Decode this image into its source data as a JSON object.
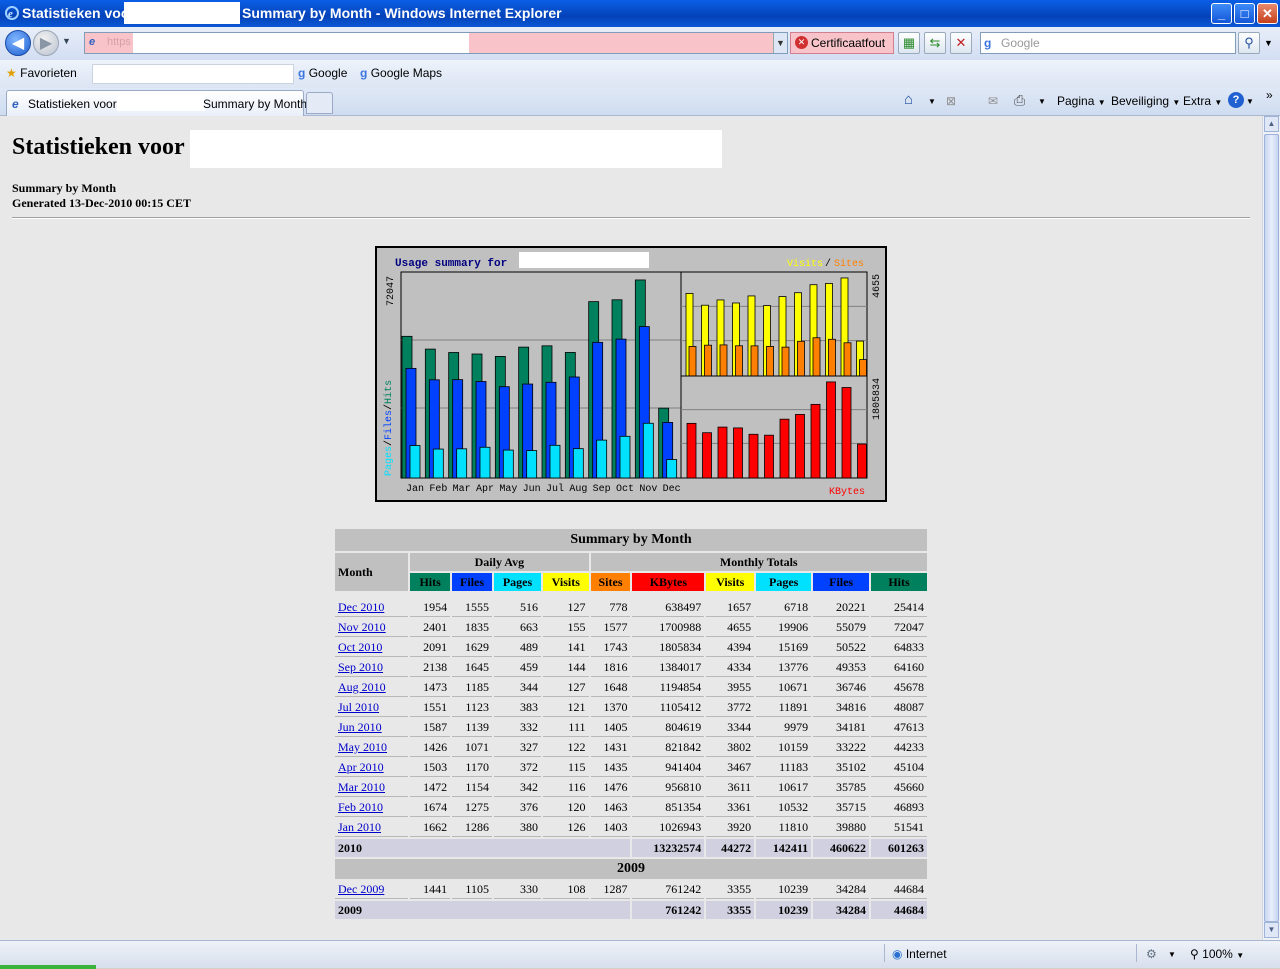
{
  "window": {
    "title_part1": "Statistieken voor",
    "title_part2": "Summary by Month - Windows Internet Explorer",
    "min": "_",
    "max": "□",
    "close": "✕"
  },
  "addressbar": {
    "url_prefix": "https",
    "certificate_error": "Certificaatfout",
    "search_placeholder": "Google"
  },
  "favorites": {
    "label": "Favorieten",
    "links": [
      "Google",
      "Google Maps"
    ]
  },
  "tab": {
    "label_part1": "Statistieken voor",
    "label_part2": "Summary by Month"
  },
  "commands": {
    "page": "Pagina",
    "safety": "Beveiliging",
    "tools": "Extra"
  },
  "page": {
    "heading": "Statistieken voor",
    "subtitle1": "Summary by Month",
    "subtitle2": "Generated 13-Dec-2010 00:15 CET"
  },
  "chart_data": {
    "type": "bar",
    "title": "Usage summary for",
    "categories": [
      "Jan",
      "Feb",
      "Mar",
      "Apr",
      "May",
      "Jun",
      "Jul",
      "Aug",
      "Sep",
      "Oct",
      "Nov",
      "Dec"
    ],
    "left_panel": {
      "ylabel_parts": [
        "Pages",
        "Files",
        "Hits"
      ],
      "ymax_label": "72047",
      "ymax": 72047,
      "series": [
        {
          "name": "Hits",
          "color": "#00805c",
          "values": [
            51541,
            46893,
            45660,
            45104,
            44233,
            47613,
            48087,
            45678,
            64160,
            64833,
            72047,
            25414
          ]
        },
        {
          "name": "Files",
          "color": "#0040ff",
          "values": [
            39880,
            35715,
            35785,
            35102,
            33222,
            34181,
            34816,
            36746,
            49353,
            50522,
            55079,
            20221
          ]
        },
        {
          "name": "Pages",
          "color": "#00e0ff",
          "values": [
            11810,
            10532,
            10617,
            11183,
            10159,
            9979,
            11891,
            10671,
            13776,
            15169,
            19906,
            6718
          ]
        }
      ]
    },
    "right_top": {
      "legend_visits": "Visits",
      "legend_sep": "/",
      "legend_sites": "Sites",
      "ymax_label": "4655",
      "ymax": 4655,
      "series": [
        {
          "name": "Visits",
          "color": "#ffff00",
          "values": [
            3920,
            3361,
            3611,
            3467,
            3802,
            3344,
            3772,
            3955,
            4334,
            4394,
            4655,
            1657
          ]
        },
        {
          "name": "Sites",
          "color": "#ff8000",
          "values": [
            1403,
            1463,
            1476,
            1435,
            1431,
            1405,
            1370,
            1648,
            1816,
            1743,
            1577,
            778
          ]
        }
      ]
    },
    "right_bottom": {
      "legend": "KBytes",
      "ymax_label": "1805834",
      "ymax": 1805834,
      "series": [
        {
          "name": "KBytes",
          "color": "#ff0000",
          "values": [
            1026943,
            851354,
            956810,
            941404,
            821842,
            804619,
            1105412,
            1194854,
            1384017,
            1805834,
            1700988,
            638497
          ]
        }
      ]
    }
  },
  "table": {
    "title": "Summary by Month",
    "month_header": "Month",
    "daily_avg": "Daily Avg",
    "monthly_totals": "Monthly Totals",
    "columns": [
      {
        "label": "Hits",
        "color": "#00805c"
      },
      {
        "label": "Files",
        "color": "#0040ff"
      },
      {
        "label": "Pages",
        "color": "#00e0ff"
      },
      {
        "label": "Visits",
        "color": "#ffff00"
      },
      {
        "label": "Sites",
        "color": "#ff8000"
      },
      {
        "label": "KBytes",
        "color": "#ff0000"
      },
      {
        "label": "Visits",
        "color": "#ffff00"
      },
      {
        "label": "Pages",
        "color": "#00e0ff"
      },
      {
        "label": "Files",
        "color": "#0040ff"
      },
      {
        "label": "Hits",
        "color": "#00805c"
      }
    ],
    "rows_2010": [
      [
        "Dec 2010",
        "1954",
        "1555",
        "516",
        "127",
        "778",
        "638497",
        "1657",
        "6718",
        "20221",
        "25414"
      ],
      [
        "Nov 2010",
        "2401",
        "1835",
        "663",
        "155",
        "1577",
        "1700988",
        "4655",
        "19906",
        "55079",
        "72047"
      ],
      [
        "Oct 2010",
        "2091",
        "1629",
        "489",
        "141",
        "1743",
        "1805834",
        "4394",
        "15169",
        "50522",
        "64833"
      ],
      [
        "Sep 2010",
        "2138",
        "1645",
        "459",
        "144",
        "1816",
        "1384017",
        "4334",
        "13776",
        "49353",
        "64160"
      ],
      [
        "Aug 2010",
        "1473",
        "1185",
        "344",
        "127",
        "1648",
        "1194854",
        "3955",
        "10671",
        "36746",
        "45678"
      ],
      [
        "Jul 2010",
        "1551",
        "1123",
        "383",
        "121",
        "1370",
        "1105412",
        "3772",
        "11891",
        "34816",
        "48087"
      ],
      [
        "Jun 2010",
        "1587",
        "1139",
        "332",
        "111",
        "1405",
        "804619",
        "3344",
        "9979",
        "34181",
        "47613"
      ],
      [
        "May 2010",
        "1426",
        "1071",
        "327",
        "122",
        "1431",
        "821842",
        "3802",
        "10159",
        "33222",
        "44233"
      ],
      [
        "Apr 2010",
        "1503",
        "1170",
        "372",
        "115",
        "1435",
        "941404",
        "3467",
        "11183",
        "35102",
        "45104"
      ],
      [
        "Mar 2010",
        "1472",
        "1154",
        "342",
        "116",
        "1476",
        "956810",
        "3611",
        "10617",
        "35785",
        "45660"
      ],
      [
        "Feb 2010",
        "1674",
        "1275",
        "376",
        "120",
        "1463",
        "851354",
        "3361",
        "10532",
        "35715",
        "46893"
      ],
      [
        "Jan 2010",
        "1662",
        "1286",
        "380",
        "126",
        "1403",
        "1026943",
        "3920",
        "11810",
        "39880",
        "51541"
      ]
    ],
    "total_2010": [
      "2010",
      "13232574",
      "44272",
      "142411",
      "460622",
      "601263"
    ],
    "year_2009": "2009",
    "rows_2009": [
      [
        "Dec 2009",
        "1441",
        "1105",
        "330",
        "108",
        "1287",
        "761242",
        "3355",
        "10239",
        "34284",
        "44684"
      ]
    ],
    "total_2009": [
      "2009",
      "761242",
      "3355",
      "10239",
      "34284",
      "44684"
    ]
  },
  "statusbar": {
    "zone": "Internet",
    "zoom": "100%"
  }
}
